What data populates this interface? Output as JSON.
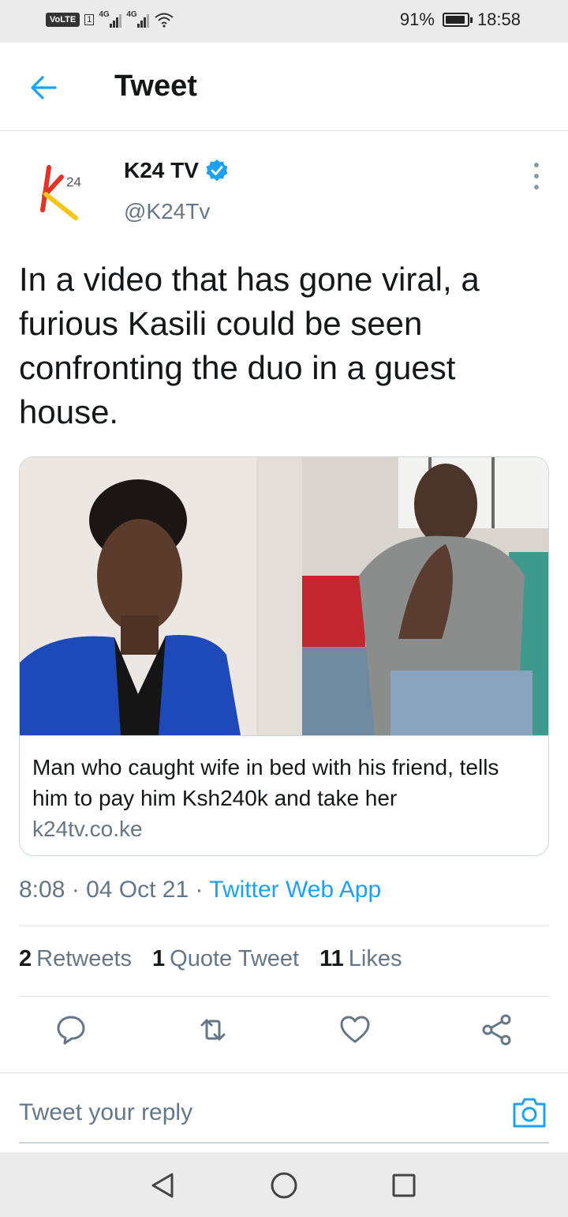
{
  "status_bar": {
    "volte": "VoLTE",
    "sim_slot": "1",
    "network1": "4G",
    "network2": "4G",
    "battery": "91%",
    "battery_level": 0.91,
    "time": "18:58"
  },
  "header": {
    "title": "Tweet"
  },
  "tweet": {
    "avatar_text": "24",
    "author_name": "K24 TV",
    "author_handle": "@K24Tv",
    "text": "In a video that has gone viral, a furious Kasili could be seen confronting the duo in a guest house.",
    "card": {
      "title": "Man who caught wife in bed with his friend, tells him to pay him Ksh240k and take her",
      "domain": "k24tv.co.ke"
    },
    "time": "8:08",
    "date": "04 Oct 21",
    "source": "Twitter Web App",
    "stats": {
      "retweets_count": "2",
      "retweets_label": "Retweets",
      "quotes_count": "1",
      "quotes_label": "Quote Tweet",
      "likes_count": "11",
      "likes_label": "Likes"
    }
  },
  "reply": {
    "placeholder": "Tweet your reply"
  },
  "colors": {
    "accent": "#1da1f2",
    "secondary_text": "#657786",
    "logo_red": "#e63226",
    "logo_yellow": "#f5c518"
  }
}
